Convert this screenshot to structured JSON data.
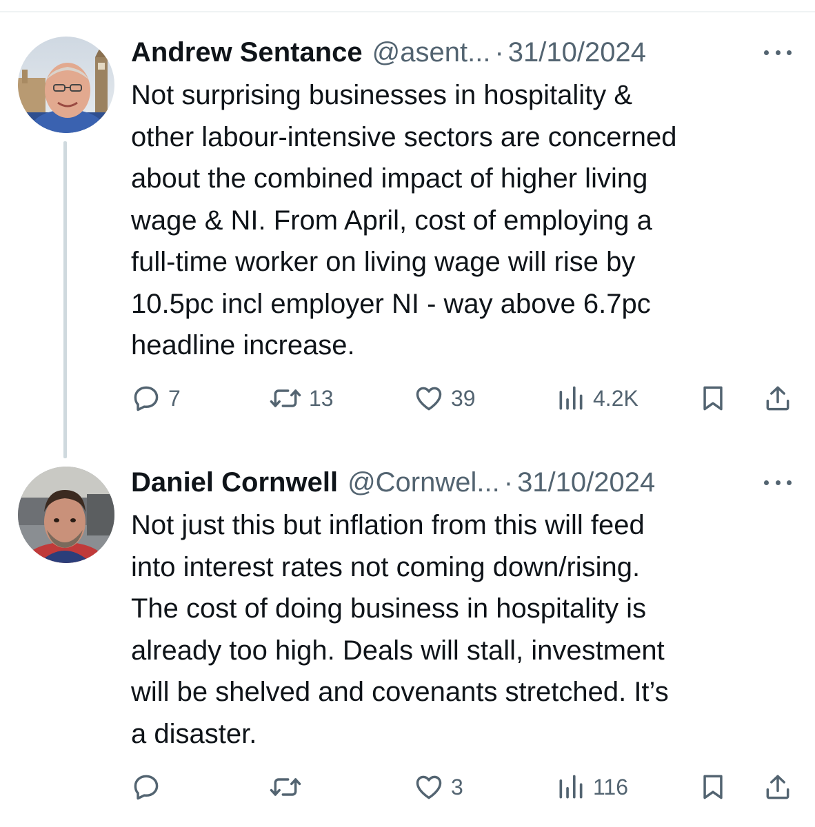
{
  "colors": {
    "text_primary": "#0f1419",
    "text_secondary": "#536471",
    "thread_line": "#cfd9de",
    "divider": "#eff3f4"
  },
  "tweets": [
    {
      "author_name": "Andrew Sentance",
      "handle": "@asent...",
      "separator": "·",
      "date": "31/10/2024",
      "text": "Not surprising businesses in hospitality &\nother labour-intensive sectors are concerned\nabout the combined impact of higher living\nwage & NI. From April, cost of employing  a\nfull-time worker on living wage will rise by\n10.5pc incl employer NI - way above 6.7pc\nheadline increase.",
      "replies": "7",
      "reposts": "13",
      "likes": "39",
      "views": "4.2K",
      "icons": [
        "reply-icon",
        "repost-icon",
        "like-icon",
        "views-icon",
        "bookmark-icon",
        "share-icon",
        "more-icon"
      ]
    },
    {
      "author_name": "Daniel Cornwell",
      "handle": "@Cornwel...",
      "separator": "·",
      "date": "31/10/2024",
      "text": "Not just this but inflation from this will feed\ninto interest rates not coming down/rising.\nThe cost of doing business in hospitality is\nalready too high. Deals will stall, investment\nwill be shelved and covenants stretched. It’s\na disaster.",
      "replies": "",
      "reposts": "",
      "likes": "3",
      "views": "116",
      "icons": [
        "reply-icon",
        "repost-icon",
        "like-icon",
        "views-icon",
        "bookmark-icon",
        "share-icon",
        "more-icon"
      ]
    }
  ]
}
